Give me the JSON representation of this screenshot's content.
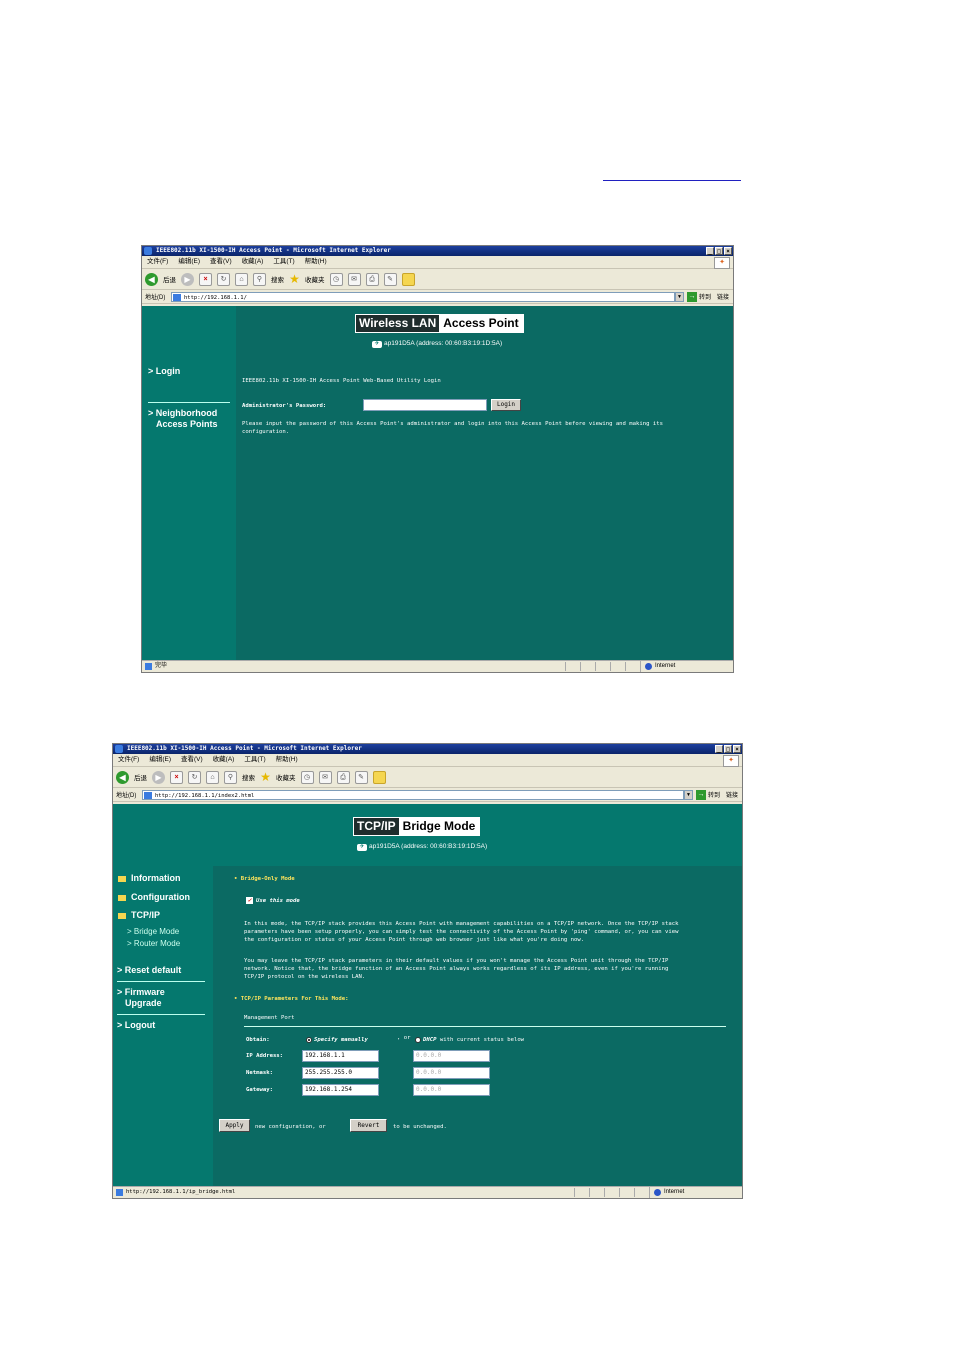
{
  "browser": {
    "title": "IEEE802.11b XI-1500-IH Access Point - Microsoft Internet Explorer",
    "menu": [
      "文件(F)",
      "编辑(E)",
      "查看(V)",
      "收藏(A)",
      "工具(T)",
      "帮助(H)"
    ],
    "back_label": "后退",
    "search_label": "搜索",
    "favorites_label": "收藏夹",
    "address_label": "地址(D)",
    "go_label": "转到",
    "links_label": "链接"
  },
  "login_window": {
    "url": "http://192.168.1.1/",
    "banner_dark": "Wireless LAN",
    "banner_light": "Access Point",
    "subtitle": "ap191D5A (address: 00:60:B3:19:1D:5A)",
    "sidebar": {
      "login": "> Login",
      "neighborhood_1": "> Neighborhood",
      "neighborhood_2": "Access Points"
    },
    "heading": "IEEE802.11b XI-1500-IH Access Point Web-Based Utility Login",
    "password_label": "Administrator's Password:",
    "password_value": "",
    "login_button": "Login",
    "instructions_1": "Please input the password of this Access Point's administrator and login into this Access Point before viewing and making its",
    "instructions_2": "configuration.",
    "status_text": "完毕",
    "zone": "Internet"
  },
  "bridge_window": {
    "url": "http://192.168.1.1/index2.html",
    "banner_dark": "TCP/IP",
    "banner_light": "Bridge Mode",
    "subtitle": "ap191D5A (address: 00:60:B3:19:1D:5A)",
    "sidebar": {
      "information": "Information",
      "configuration": "Configuration",
      "tcpip": "TCP/IP",
      "bridge_mode": "> Bridge Mode",
      "router_mode": "> Router Mode",
      "reset_default": "> Reset default",
      "firmware_1": "> Firmware",
      "firmware_2": "Upgrade",
      "logout": "> Logout"
    },
    "section1_title": "• Bridge-Only Mode",
    "use_mode_label": "Use this mode",
    "para1": [
      "In this mode, the TCP/IP stack provides this Access Point with management capabilities on a TCP/IP network. Once the TCP/IP stack",
      "parameters have been setup properly, you can simply test the connectivity of the Access Point by 'ping' command, or, you can view",
      "the configuration or status of your Access Point through web browser just like what you're doing now."
    ],
    "para2": [
      "You may leave the TCP/IP stack parameters in their default values if you won't manage the Access Point unit through the TCP/IP",
      "network. Notice that, the bridge function of an Access Point always works regardless of its IP address, even if you're running",
      "TCP/IP protocol on the wireless LAN."
    ],
    "section2_title": "• TCP/IP Parameters For This Mode:",
    "port_label": "Management Port",
    "obtain_label": "Obtain:",
    "specify_label": "Specify manually",
    "or_label": ", or",
    "dhcp_label": "DHCP",
    "dhcp_suffix": "with current status below",
    "ip_label": "IP Address:",
    "netmask_label": "Netmask:",
    "gateway_label": "Gateway:",
    "ip_value": "192.168.1.1",
    "netmask_value": "255.255.255.0",
    "gateway_value": "192.168.1.254",
    "dhcp_ip": "0.0.0.0",
    "dhcp_netmask": "0.0.0.0",
    "dhcp_gateway": "0.0.0.0",
    "apply_button": "Apply",
    "apply_text": "new configuration, or",
    "revert_button": "Revert",
    "revert_text": "to be unchanged.",
    "status_url": "http://192.168.1.1/ip_bridge.html",
    "zone": "Internet"
  }
}
